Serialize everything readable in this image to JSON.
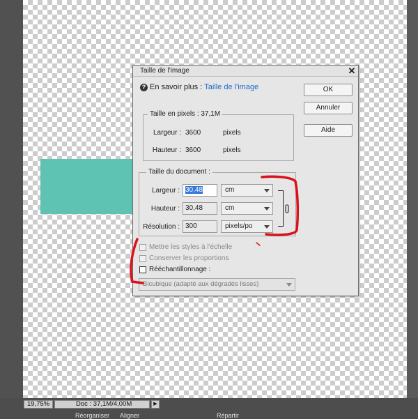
{
  "dialog": {
    "title": "Taille de l'image",
    "help_prefix": "En savoir plus :",
    "help_link": "Taille de l'image",
    "buttons": {
      "ok": "OK",
      "cancel": "Annuler",
      "help": "Aide"
    }
  },
  "pixel_dimensions": {
    "legend": "Taille en pixels :  37,1M",
    "width_label": "Largeur :",
    "width_value": "3600",
    "width_unit": "pixels",
    "height_label": "Hauteur :",
    "height_value": "3600",
    "height_unit": "pixels"
  },
  "document_size": {
    "legend": "Taille du document :",
    "width_label": "Largeur :",
    "width_value": "30,48",
    "width_unit": "cm",
    "height_label": "Hauteur :",
    "height_value": "30,48",
    "height_unit": "cm",
    "resolution_label": "Résolution :",
    "resolution_value": "300",
    "resolution_unit": "pixels/po"
  },
  "options": {
    "scale_styles": {
      "label": "Mettre les styles à l'échelle",
      "checked": false,
      "enabled": false
    },
    "constrain": {
      "label": "Conserver les proportions",
      "checked": false,
      "enabled": false
    },
    "resample": {
      "label": "Rééchantillonnage :",
      "checked": false,
      "enabled": true
    },
    "resample_method": "Bicubique (adapté aux dégradés lisses)"
  },
  "status_bar": {
    "zoom": "19,75%",
    "doc_info": "Doc : 37,1M/4,00M"
  },
  "bottom_panel": {
    "tabs": [
      "Réorganiser",
      "Aligner",
      "Répartir"
    ]
  },
  "colors": {
    "shape": "#5ec3b2",
    "link": "#1d69c9",
    "annotation": "#d9121b",
    "selection": "#3478d8"
  }
}
